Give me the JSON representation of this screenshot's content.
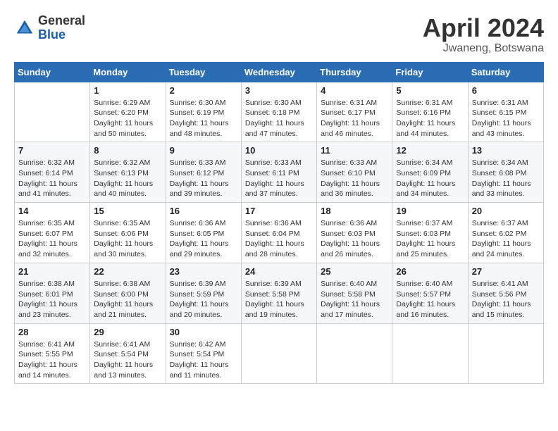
{
  "logo": {
    "general": "General",
    "blue": "Blue"
  },
  "title": "April 2024",
  "location": "Jwaneng, Botswana",
  "days_of_week": [
    "Sunday",
    "Monday",
    "Tuesday",
    "Wednesday",
    "Thursday",
    "Friday",
    "Saturday"
  ],
  "weeks": [
    [
      {
        "day": "",
        "info": ""
      },
      {
        "day": "1",
        "info": "Sunrise: 6:29 AM\nSunset: 6:20 PM\nDaylight: 11 hours\nand 50 minutes."
      },
      {
        "day": "2",
        "info": "Sunrise: 6:30 AM\nSunset: 6:19 PM\nDaylight: 11 hours\nand 48 minutes."
      },
      {
        "day": "3",
        "info": "Sunrise: 6:30 AM\nSunset: 6:18 PM\nDaylight: 11 hours\nand 47 minutes."
      },
      {
        "day": "4",
        "info": "Sunrise: 6:31 AM\nSunset: 6:17 PM\nDaylight: 11 hours\nand 46 minutes."
      },
      {
        "day": "5",
        "info": "Sunrise: 6:31 AM\nSunset: 6:16 PM\nDaylight: 11 hours\nand 44 minutes."
      },
      {
        "day": "6",
        "info": "Sunrise: 6:31 AM\nSunset: 6:15 PM\nDaylight: 11 hours\nand 43 minutes."
      }
    ],
    [
      {
        "day": "7",
        "info": "Sunrise: 6:32 AM\nSunset: 6:14 PM\nDaylight: 11 hours\nand 41 minutes."
      },
      {
        "day": "8",
        "info": "Sunrise: 6:32 AM\nSunset: 6:13 PM\nDaylight: 11 hours\nand 40 minutes."
      },
      {
        "day": "9",
        "info": "Sunrise: 6:33 AM\nSunset: 6:12 PM\nDaylight: 11 hours\nand 39 minutes."
      },
      {
        "day": "10",
        "info": "Sunrise: 6:33 AM\nSunset: 6:11 PM\nDaylight: 11 hours\nand 37 minutes."
      },
      {
        "day": "11",
        "info": "Sunrise: 6:33 AM\nSunset: 6:10 PM\nDaylight: 11 hours\nand 36 minutes."
      },
      {
        "day": "12",
        "info": "Sunrise: 6:34 AM\nSunset: 6:09 PM\nDaylight: 11 hours\nand 34 minutes."
      },
      {
        "day": "13",
        "info": "Sunrise: 6:34 AM\nSunset: 6:08 PM\nDaylight: 11 hours\nand 33 minutes."
      }
    ],
    [
      {
        "day": "14",
        "info": "Sunrise: 6:35 AM\nSunset: 6:07 PM\nDaylight: 11 hours\nand 32 minutes."
      },
      {
        "day": "15",
        "info": "Sunrise: 6:35 AM\nSunset: 6:06 PM\nDaylight: 11 hours\nand 30 minutes."
      },
      {
        "day": "16",
        "info": "Sunrise: 6:36 AM\nSunset: 6:05 PM\nDaylight: 11 hours\nand 29 minutes."
      },
      {
        "day": "17",
        "info": "Sunrise: 6:36 AM\nSunset: 6:04 PM\nDaylight: 11 hours\nand 28 minutes."
      },
      {
        "day": "18",
        "info": "Sunrise: 6:36 AM\nSunset: 6:03 PM\nDaylight: 11 hours\nand 26 minutes."
      },
      {
        "day": "19",
        "info": "Sunrise: 6:37 AM\nSunset: 6:03 PM\nDaylight: 11 hours\nand 25 minutes."
      },
      {
        "day": "20",
        "info": "Sunrise: 6:37 AM\nSunset: 6:02 PM\nDaylight: 11 hours\nand 24 minutes."
      }
    ],
    [
      {
        "day": "21",
        "info": "Sunrise: 6:38 AM\nSunset: 6:01 PM\nDaylight: 11 hours\nand 23 minutes."
      },
      {
        "day": "22",
        "info": "Sunrise: 6:38 AM\nSunset: 6:00 PM\nDaylight: 11 hours\nand 21 minutes."
      },
      {
        "day": "23",
        "info": "Sunrise: 6:39 AM\nSunset: 5:59 PM\nDaylight: 11 hours\nand 20 minutes."
      },
      {
        "day": "24",
        "info": "Sunrise: 6:39 AM\nSunset: 5:58 PM\nDaylight: 11 hours\nand 19 minutes."
      },
      {
        "day": "25",
        "info": "Sunrise: 6:40 AM\nSunset: 5:58 PM\nDaylight: 11 hours\nand 17 minutes."
      },
      {
        "day": "26",
        "info": "Sunrise: 6:40 AM\nSunset: 5:57 PM\nDaylight: 11 hours\nand 16 minutes."
      },
      {
        "day": "27",
        "info": "Sunrise: 6:41 AM\nSunset: 5:56 PM\nDaylight: 11 hours\nand 15 minutes."
      }
    ],
    [
      {
        "day": "28",
        "info": "Sunrise: 6:41 AM\nSunset: 5:55 PM\nDaylight: 11 hours\nand 14 minutes."
      },
      {
        "day": "29",
        "info": "Sunrise: 6:41 AM\nSunset: 5:54 PM\nDaylight: 11 hours\nand 13 minutes."
      },
      {
        "day": "30",
        "info": "Sunrise: 6:42 AM\nSunset: 5:54 PM\nDaylight: 11 hours\nand 11 minutes."
      },
      {
        "day": "",
        "info": ""
      },
      {
        "day": "",
        "info": ""
      },
      {
        "day": "",
        "info": ""
      },
      {
        "day": "",
        "info": ""
      }
    ]
  ]
}
